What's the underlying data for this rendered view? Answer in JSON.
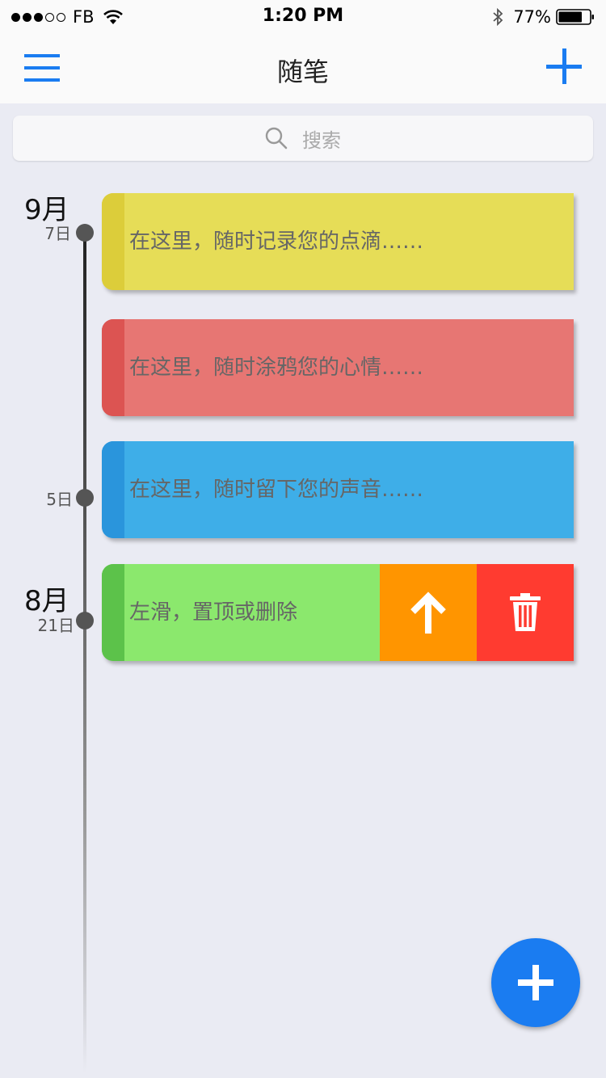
{
  "status_bar": {
    "carrier": "FB",
    "time": "1:20 PM",
    "battery": "77%",
    "battery_level": 0.77,
    "signal_bars_full": 3,
    "signal_bars_total": 5
  },
  "nav": {
    "title": "随笔",
    "menu_icon": "hamburger-menu-icon",
    "add_icon": "plus-icon"
  },
  "search": {
    "placeholder": "搜索",
    "icon": "search-icon"
  },
  "timeline": {
    "months": [
      {
        "label": "9月"
      },
      {
        "label": "8月"
      }
    ],
    "days": [
      {
        "label": "7日"
      },
      {
        "label": "5日"
      },
      {
        "label": "21日"
      }
    ]
  },
  "notes": [
    {
      "text": "在这里，随时记录您的点滴……",
      "color": "#e6dd57",
      "stripe_color": "#dccd3a"
    },
    {
      "text": "在这里，随时涂鸦您的心情……",
      "color": "#e77673",
      "stripe_color": "#dc5452"
    },
    {
      "text": "在这里，随时留下您的声音……",
      "color": "#3eaee8",
      "stripe_color": "#2a95dc"
    },
    {
      "text": "左滑，置顶或删除",
      "color": "#8be86d",
      "stripe_color": "#5cc24a"
    }
  ],
  "swipe_actions": {
    "pin_icon": "arrow-up-icon",
    "pin_color": "#ff9500",
    "delete_icon": "trash-icon",
    "delete_color": "#ff3b30"
  },
  "fab": {
    "icon": "plus-icon",
    "color": "#1a7cf1"
  }
}
